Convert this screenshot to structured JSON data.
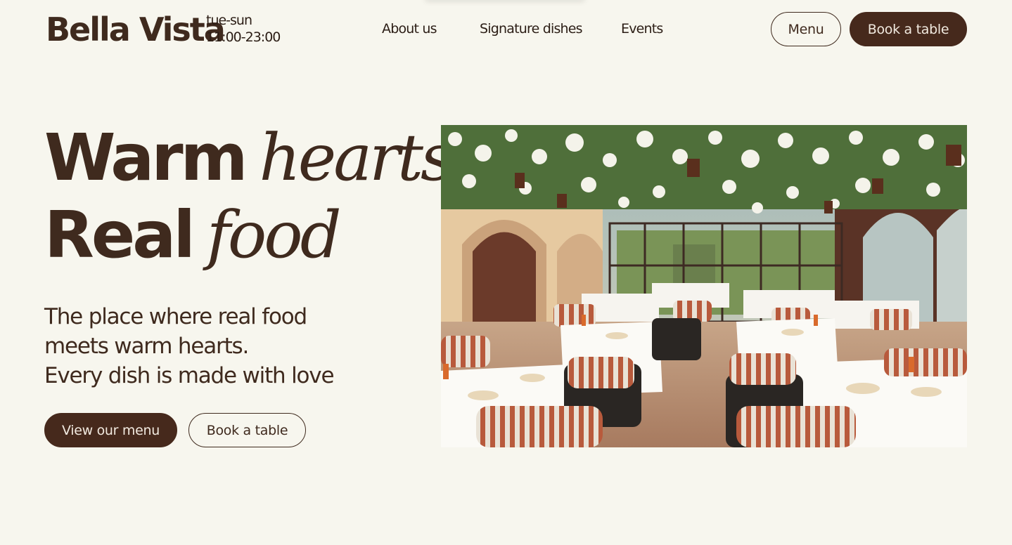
{
  "brand": {
    "name": "Bella Vista"
  },
  "hours": {
    "days": "tue-sun",
    "time": "11:00-23:00"
  },
  "nav": {
    "items": [
      {
        "label": "About us"
      },
      {
        "label": "Signature dishes"
      },
      {
        "label": "Events"
      }
    ]
  },
  "header_actions": {
    "menu_label": "Menu",
    "book_label": "Book a table"
  },
  "hero": {
    "line1_sans": "Warm",
    "line1_serif": "hearts,",
    "line2_sans": "Real",
    "line2_serif": "food",
    "lead_lines": [
      "The place where real food",
      "meets warm hearts.",
      "Every dish is made with love"
    ],
    "primary_cta": "View our menu",
    "secondary_cta": "Book a table"
  },
  "colors": {
    "background": "#f7f6ee",
    "brand_brown": "#46291c",
    "text": "#3f2a1e"
  }
}
